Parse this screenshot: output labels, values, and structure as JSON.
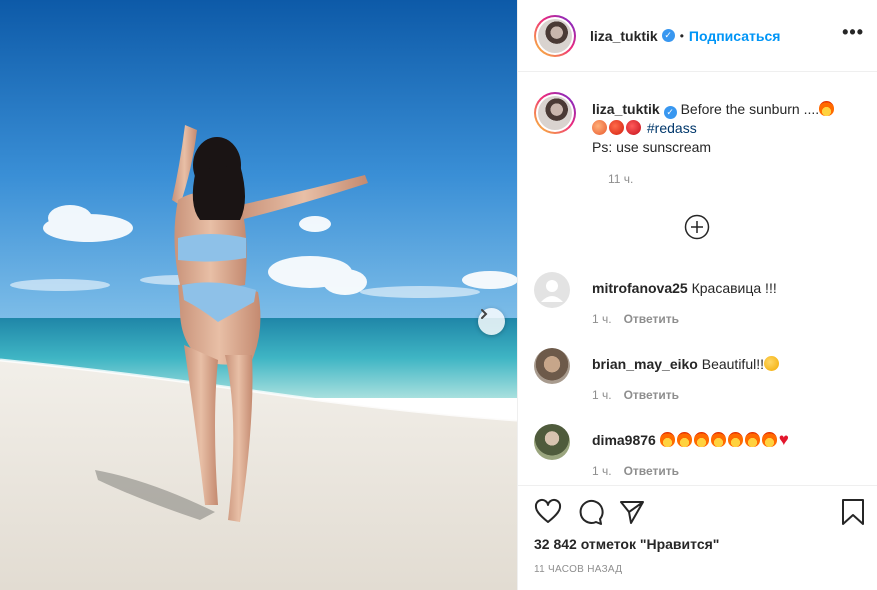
{
  "header": {
    "username": "liza_tuktik",
    "separator": "•",
    "follow_label": "Подписаться",
    "more_label": "•••"
  },
  "caption": {
    "username": "liza_tuktik",
    "text_line1": "Before the sunburn ....",
    "hashtag": "#redass",
    "text_line2": "Ps: use sunscream",
    "time": "11 ч."
  },
  "comments": [
    {
      "username": "mitrofanova25",
      "text": "Красавица !!!",
      "time": "1 ч.",
      "reply_label": "Ответить"
    },
    {
      "username": "brian_may_eiko",
      "text": "Beautiful!!",
      "time": "1 ч.",
      "reply_label": "Ответить"
    },
    {
      "username": "dima9876",
      "text": "",
      "time": "1 ч.",
      "reply_label": "Ответить"
    }
  ],
  "footer": {
    "likes": "32 842 отметок \"Нравится\"",
    "time_ago": "11 ЧАСОВ НАЗАД"
  },
  "icons": [
    "verified-badge-icon",
    "add-comment-icon",
    "heart-icon",
    "comment-icon",
    "share-icon",
    "bookmark-icon",
    "chevron-right-icon"
  ],
  "colors": {
    "link": "#0095f6",
    "hashtag": "#00376b",
    "muted": "#8e8e8e",
    "verified": "#3897f0"
  }
}
